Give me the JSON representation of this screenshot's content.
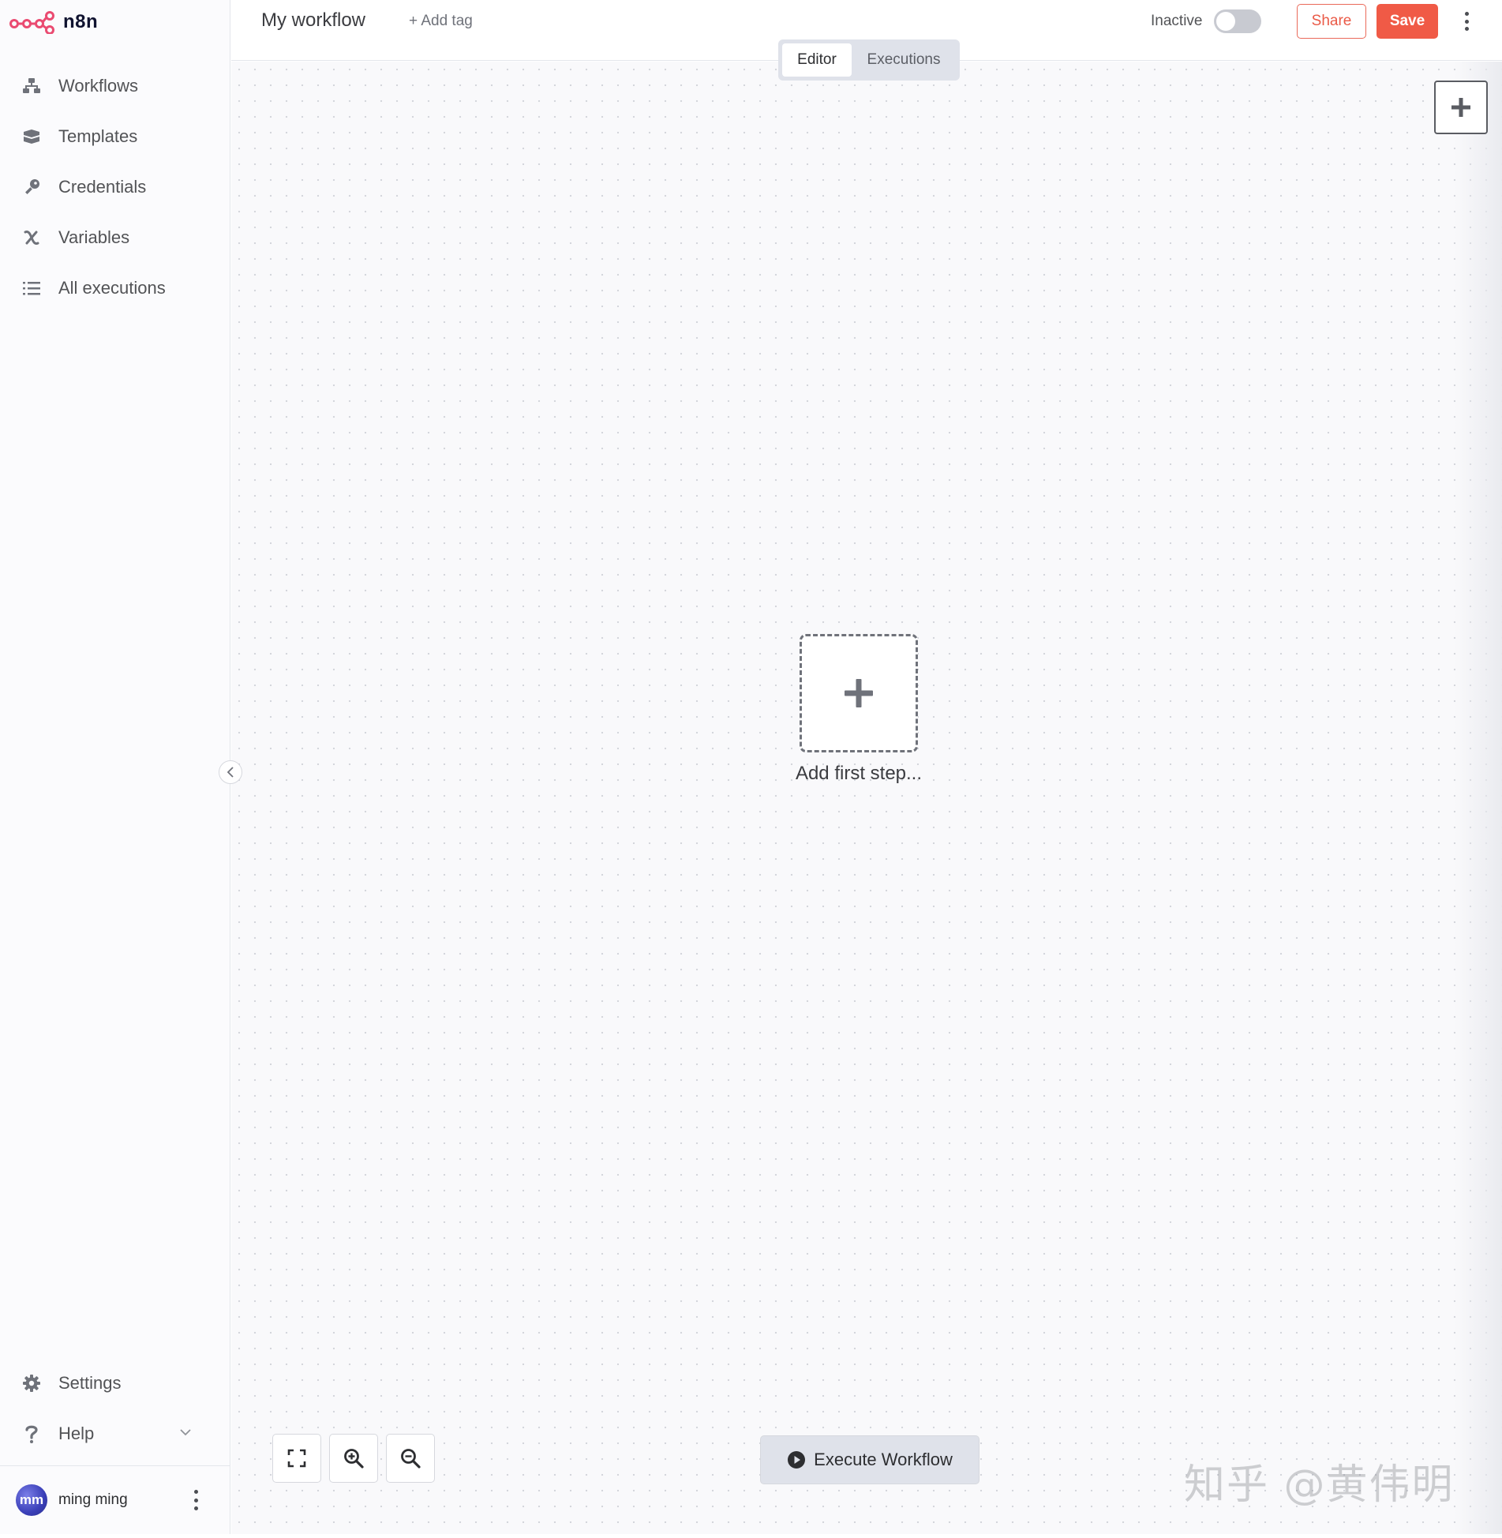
{
  "app": {
    "name": "n8n",
    "brand_color": "#ea4b71"
  },
  "sidebar": {
    "items": [
      {
        "label": "Workflows",
        "icon": "workflows-icon"
      },
      {
        "label": "Templates",
        "icon": "templates-icon"
      },
      {
        "label": "Credentials",
        "icon": "key-icon"
      },
      {
        "label": "Variables",
        "icon": "variables-icon"
      },
      {
        "label": "All executions",
        "icon": "list-icon"
      }
    ],
    "bottom_items": [
      {
        "label": "Settings",
        "icon": "gear-icon"
      },
      {
        "label": "Help",
        "icon": "question-icon"
      }
    ],
    "user": {
      "initials": "mm",
      "name": "ming ming"
    }
  },
  "header": {
    "workflow_name": "My workflow",
    "add_tag": "+ Add tag",
    "status": "Inactive",
    "active": false,
    "share_label": "Share",
    "save_label": "Save",
    "accent_color": "#f05a46"
  },
  "tabs": [
    {
      "label": "Editor",
      "active": true
    },
    {
      "label": "Executions",
      "active": false
    }
  ],
  "canvas": {
    "add_first_step": "Add first step...",
    "execute_label": "Execute Workflow"
  },
  "watermark": "知乎 @黄伟明"
}
